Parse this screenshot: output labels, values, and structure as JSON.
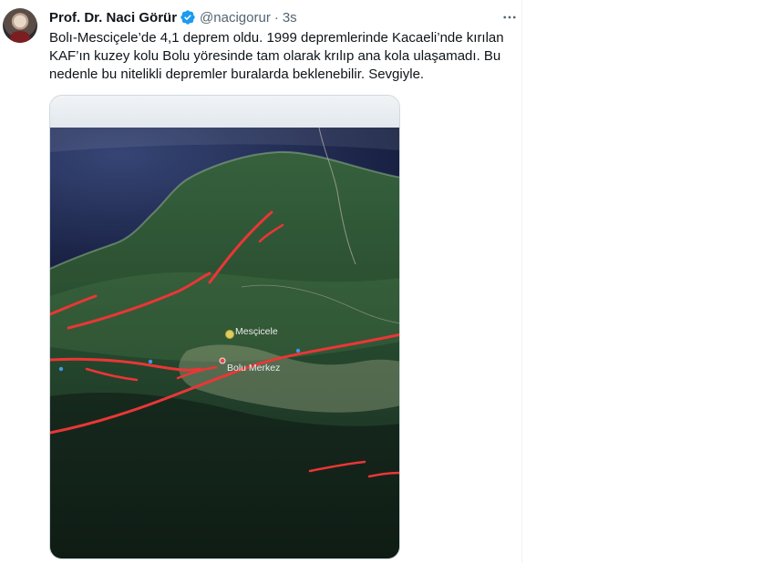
{
  "tweet": {
    "display_name": "Prof. Dr. Naci Görür",
    "handle": "@nacigorur",
    "separator": "·",
    "timestamp": "3s",
    "verified_icon": "verified-badge-icon",
    "more_icon": "more-options-icon",
    "text": "Bolı-Mesciçele’de 4,1 deprem oldu. 1999 depremlerinde Kacaeli’nde kırılan KAF’ın kuzey kolu Bolu yöresinde tam olarak krılıp ana kola ulaşamadı. Bu nedenle bu nitelikli depremler buralarda beklenebilir. Sevgiyle."
  },
  "media": {
    "labels": {
      "mescicele": "Mesçicele",
      "bolu_merkez": "Bolu Merkez"
    }
  },
  "colors": {
    "accent": "#1d9bf0",
    "secondary_text": "#536471",
    "fault_line": "#ff3b3b"
  }
}
